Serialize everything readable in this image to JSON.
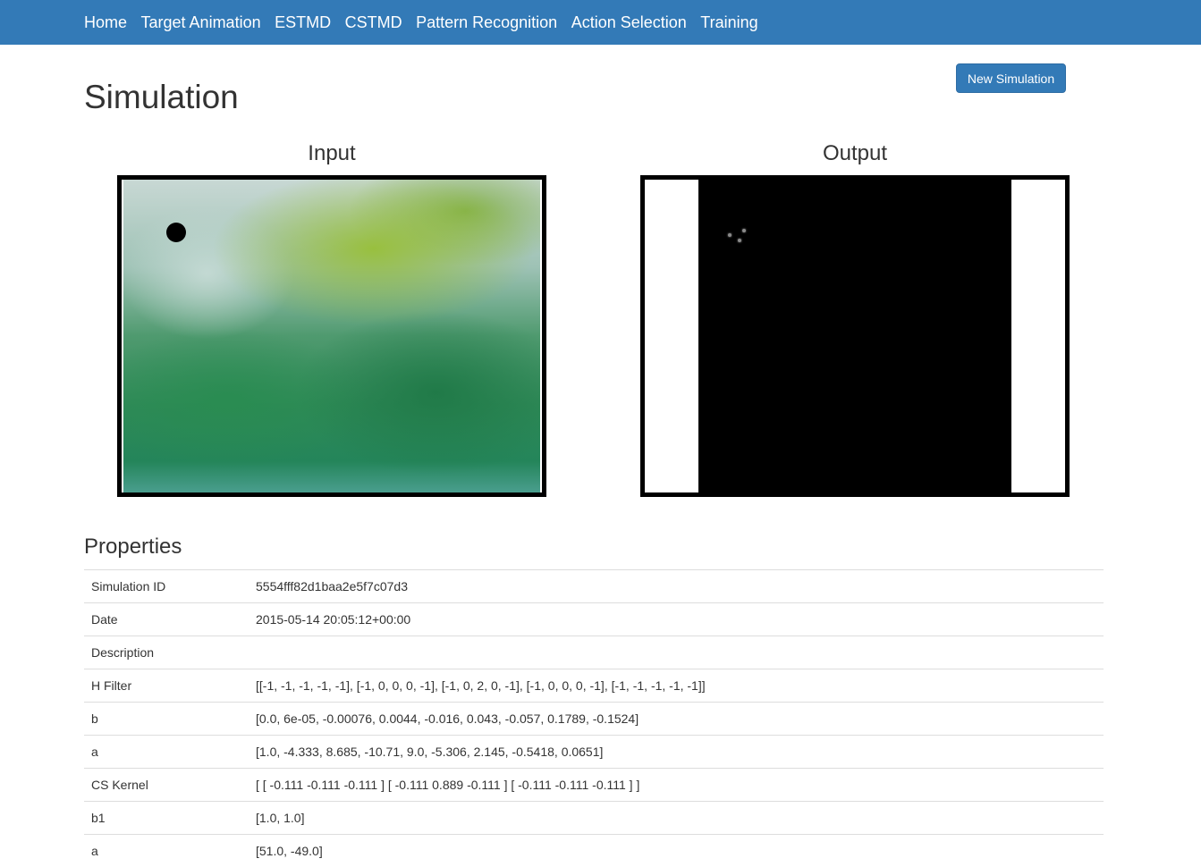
{
  "nav": {
    "links": [
      "Home",
      "Target Animation",
      "ESTMD",
      "CSTMD",
      "Pattern Recognition",
      "Action Selection",
      "Training"
    ]
  },
  "page": {
    "title": "Simulation",
    "new_simulation_label": "New Simulation"
  },
  "panels": {
    "input_title": "Input",
    "output_title": "Output"
  },
  "properties": {
    "heading": "Properties",
    "rows": [
      {
        "key": "Simulation ID",
        "value": "5554fff82d1baa2e5f7c07d3"
      },
      {
        "key": "Date",
        "value": "2015-05-14 20:05:12+00:00"
      },
      {
        "key": "Description",
        "value": ""
      },
      {
        "key": "H Filter",
        "value": "[[-1, -1, -1, -1, -1], [-1, 0, 0, 0, -1], [-1, 0, 2, 0, -1], [-1, 0, 0, 0, -1], [-1, -1, -1, -1, -1]]"
      },
      {
        "key": "b",
        "value": "[0.0, 6e-05, -0.00076, 0.0044, -0.016, 0.043, -0.057, 0.1789, -0.1524]"
      },
      {
        "key": "a",
        "value": "[1.0, -4.333, 8.685, -10.71, 9.0, -5.306, 2.145, -0.5418, 0.0651]"
      },
      {
        "key": "CS Kernel",
        "value": "[ [ -0.111 -0.111 -0.111 ] [ -0.111 0.889 -0.111 ] [ -0.111 -0.111 -0.111 ] ]"
      },
      {
        "key": "b1",
        "value": "[1.0, 1.0]"
      },
      {
        "key": "a",
        "value": "[51.0, -49.0]"
      }
    ]
  },
  "colors": {
    "navbar": "#337ab7",
    "button": "#337ab7"
  }
}
